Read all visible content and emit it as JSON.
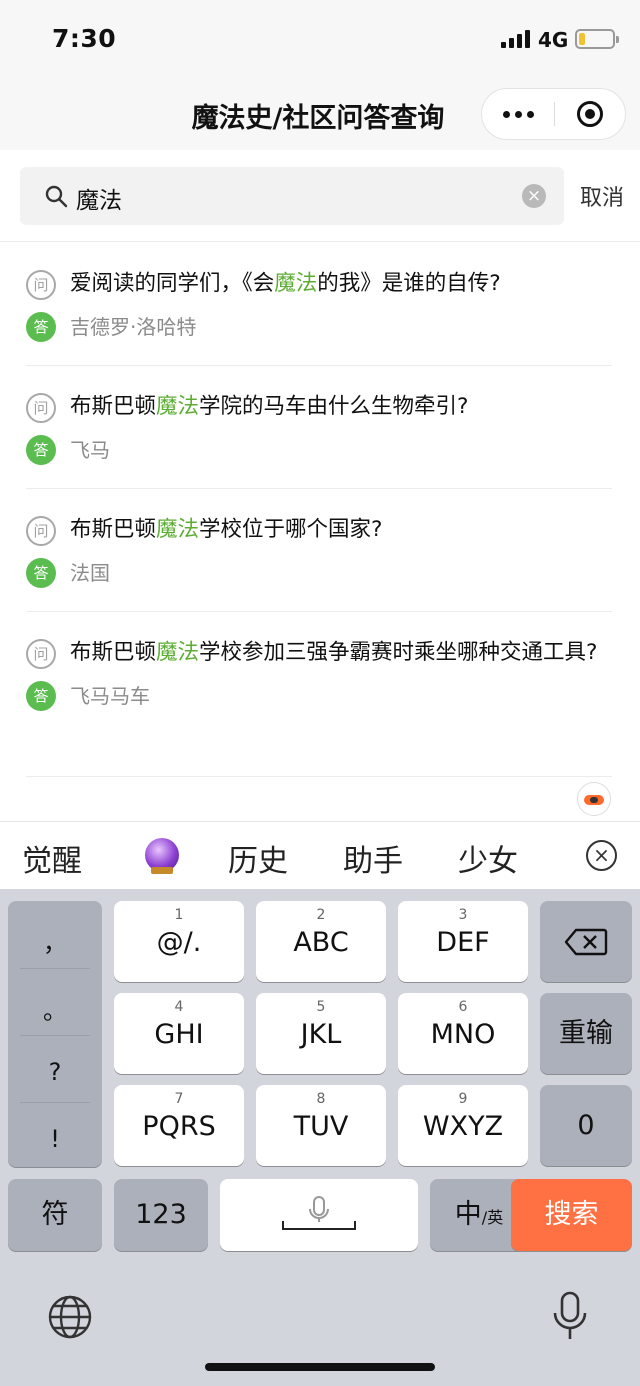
{
  "status": {
    "time": "7:30",
    "network": "4G"
  },
  "nav": {
    "title": "魔法史/社区问答查询"
  },
  "search": {
    "query": "魔法",
    "cancel": "取消"
  },
  "results": [
    {
      "q_icon": "问",
      "q_before": "爱阅读的同学们，《会",
      "q_hl": "魔法",
      "q_after": "的我》是谁的自传?",
      "a_icon": "答",
      "answer": "吉德罗·洛哈特"
    },
    {
      "q_icon": "问",
      "q_before": "布斯巴顿",
      "q_hl": "魔法",
      "q_after": "学院的马车由什么生物牵引?",
      "a_icon": "答",
      "answer": "飞马"
    },
    {
      "q_icon": "问",
      "q_before": "布斯巴顿",
      "q_hl": "魔法",
      "q_after": "学校位于哪个国家?",
      "a_icon": "答",
      "answer": "法国"
    },
    {
      "q_icon": "问",
      "q_before": "布斯巴顿",
      "q_hl": "魔法",
      "q_after": "学校参加三强争霸赛时乘坐哪种交通工具?",
      "a_icon": "答",
      "answer": "飞马马车"
    }
  ],
  "keyboard": {
    "suggestions": [
      "觉醒",
      "历史",
      "助手",
      "少女"
    ],
    "punct": [
      "，",
      "。",
      "?",
      "!"
    ],
    "keys": [
      {
        "num": "1",
        "label": "@/."
      },
      {
        "num": "2",
        "label": "ABC"
      },
      {
        "num": "3",
        "label": "DEF"
      },
      {
        "num": "4",
        "label": "GHI"
      },
      {
        "num": "5",
        "label": "JKL"
      },
      {
        "num": "6",
        "label": "MNO"
      },
      {
        "num": "7",
        "label": "PQRS"
      },
      {
        "num": "8",
        "label": "TUV"
      },
      {
        "num": "9",
        "label": "WXYZ"
      }
    ],
    "reinput": "重输",
    "zero": "0",
    "symbols": "符",
    "numbers": "123",
    "lang_main": "中",
    "lang_sub": "/英",
    "search": "搜索"
  },
  "colors": {
    "highlight": "#5cad33",
    "answer_badge": "#5bbd50",
    "search_key": "#ff7043"
  }
}
